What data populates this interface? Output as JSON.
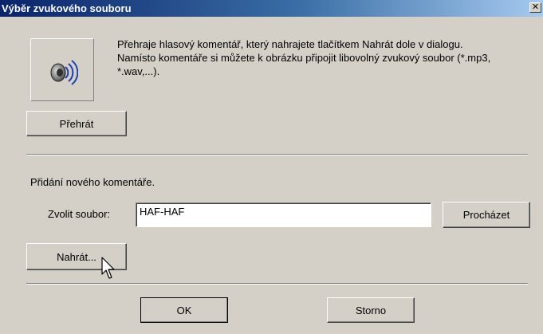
{
  "window": {
    "title": "Výběr zvukového souboru",
    "close_glyph": "✕"
  },
  "playback": {
    "icon": "speaker-icon",
    "description": "Přehraje hlasový komentář, který nahrajete tlačítkem Nahrát dole v dialogu. Namísto komentáře si můžete k obrázku připojit libovolný zvukový soubor (*.mp3, *.wav,...).",
    "play_label": "Přehrát"
  },
  "add_comment": {
    "heading": "Přidání nového komentáře.",
    "file_label": "Zvolit soubor:",
    "file_value": "HAF-HAF",
    "browse_label": "Procházet",
    "record_label": "Nahrát..."
  },
  "footer": {
    "ok_label": "OK",
    "cancel_label": "Storno"
  }
}
